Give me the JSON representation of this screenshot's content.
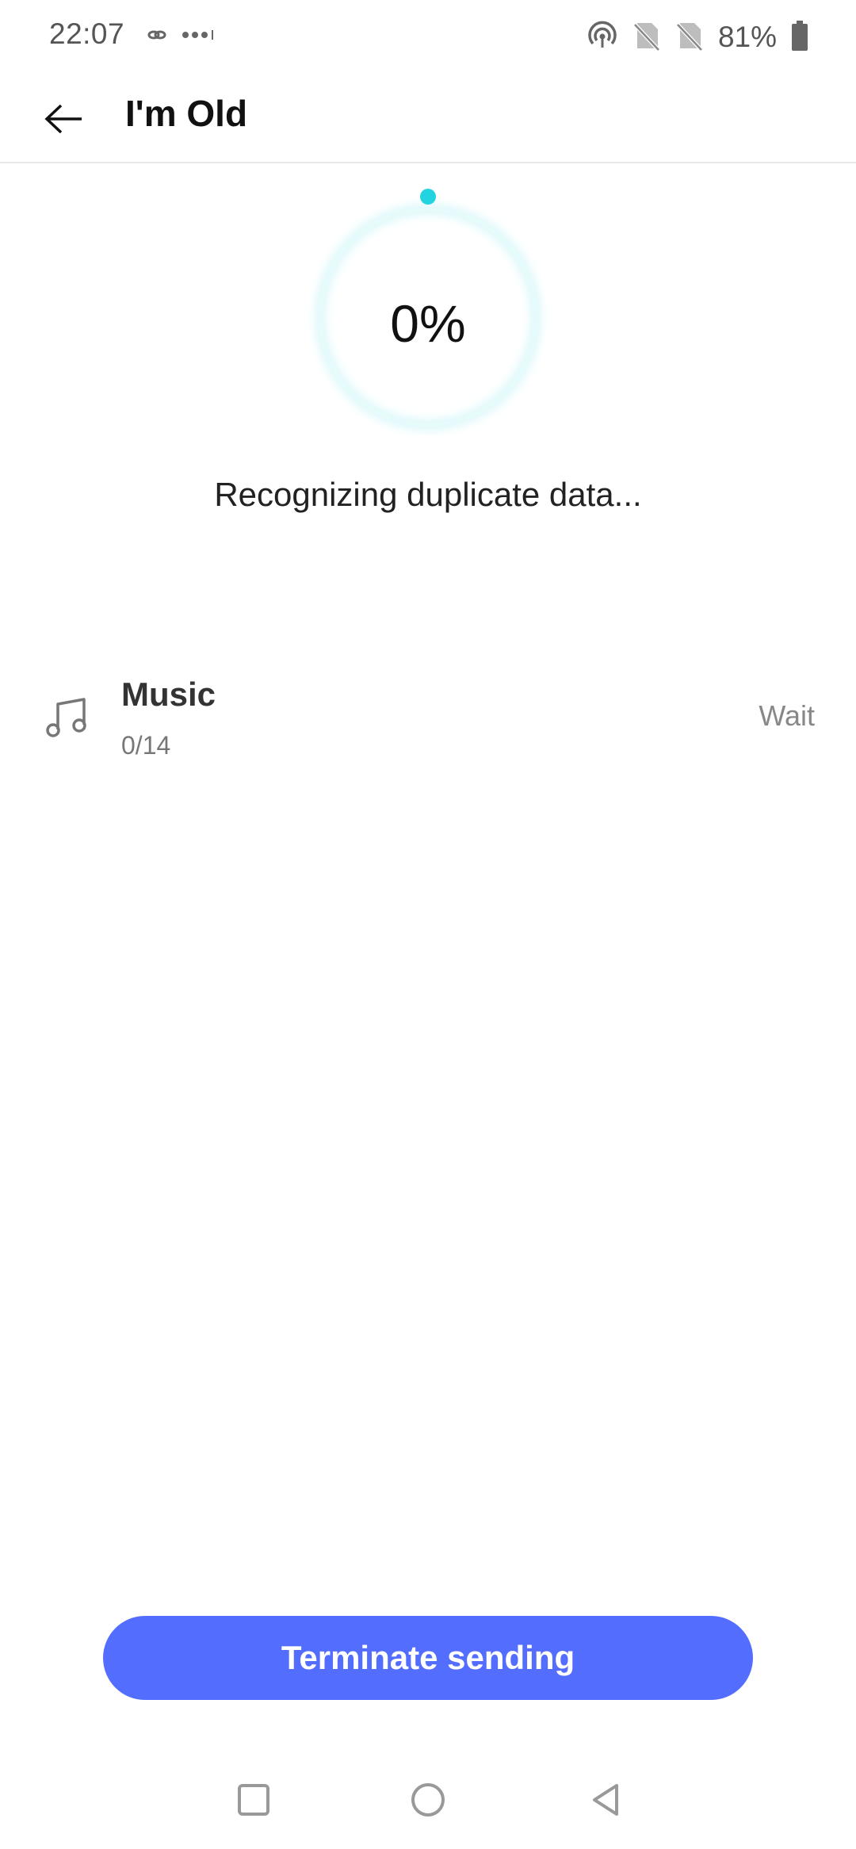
{
  "status_bar": {
    "time": "22:07",
    "battery": "81%",
    "icons_left": [
      "link-icon",
      "more-dots-icon"
    ],
    "icons_right": [
      "hotspot-icon",
      "no-sim-icon",
      "no-sim-icon",
      "battery-icon"
    ]
  },
  "app_bar": {
    "title": "I'm Old",
    "back_icon": "back-arrow-icon"
  },
  "progress": {
    "percent_text": "0%",
    "value": 0,
    "message": "Recognizing duplicate data...",
    "accent_color": "#22d3e0"
  },
  "items": [
    {
      "icon": "music-note-icon",
      "title": "Music",
      "count": "0/14",
      "status": "Wait"
    }
  ],
  "actions": {
    "terminate_label": "Terminate sending",
    "button_color": "#536dfe"
  },
  "nav_bar": {
    "buttons": [
      "recents-icon",
      "home-icon",
      "back-icon"
    ]
  }
}
